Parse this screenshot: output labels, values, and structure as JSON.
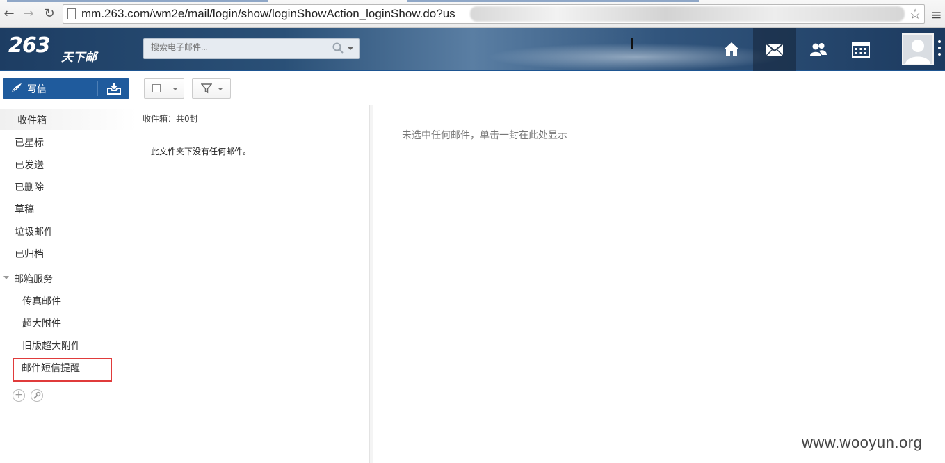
{
  "browser": {
    "url": "mm.263.com/wm2e/mail/login/show/loginShowAction_loginShow.do?us"
  },
  "header": {
    "logo_mark": "263",
    "logo_text": "天下邮",
    "search_placeholder": "搜索电子邮件...",
    "nav_items": [
      "home-icon",
      "mail-icon",
      "contacts-icon",
      "calendar-icon"
    ],
    "active_nav": "mail-icon"
  },
  "sidebar": {
    "compose_label": "写信",
    "folders": [
      "收件箱",
      "已星标",
      "已发送",
      "已删除",
      "草稿",
      "垃圾邮件",
      "已归档"
    ],
    "active_folder": "收件箱",
    "services_group": "邮箱服务",
    "services": [
      "传真邮件",
      "超大附件",
      "旧版超大附件",
      "邮件短信提醒"
    ]
  },
  "list": {
    "header_prefix": "收件箱",
    "header_count": "：共0封",
    "empty_message": "此文件夹下没有任何邮件。"
  },
  "reading": {
    "empty_message": "未选中任何邮件，单击一封在此处显示"
  },
  "watermark": "www.wooyun.org",
  "colors": {
    "accent": "#1f5b9d",
    "highlight": "#e03b3b",
    "header_bg": "#2a5077"
  }
}
